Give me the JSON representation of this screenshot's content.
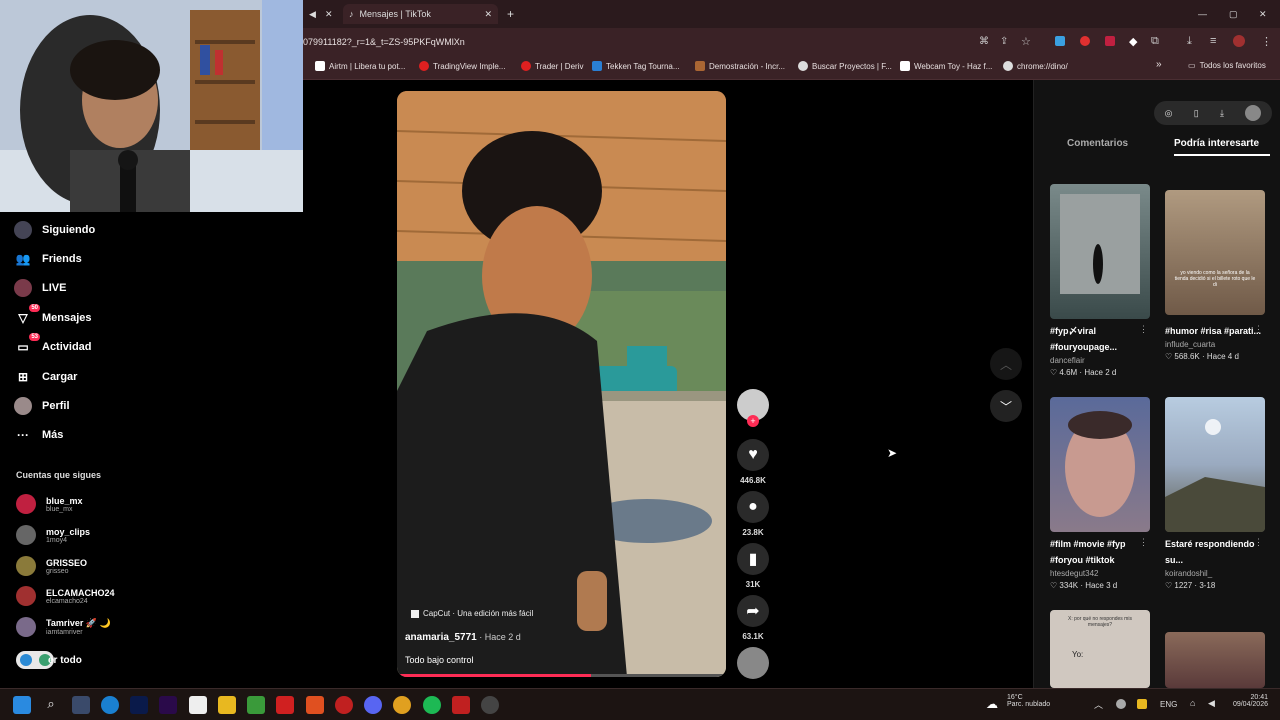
{
  "browser": {
    "tab_close_glyph": "✕",
    "tab_title": "Mensajes | TikTok",
    "new_tab_glyph": "+",
    "url": "079911182?_r=1&_t=ZS-95PKFqWMlXn",
    "window_controls": [
      "—",
      "▢",
      "✕"
    ],
    "bookmarks": [
      {
        "label": "Airtm | Libera tu pot...",
        "color": "#ffffff"
      },
      {
        "label": "TradingView Imple...",
        "color": "#e02020"
      },
      {
        "label": "Trader | Deriv",
        "color": "#e02020"
      },
      {
        "label": "Tekken Tag Tourna...",
        "color": "#2a7fd4"
      },
      {
        "label": "Demostración - Incr...",
        "color": "#aa6633"
      },
      {
        "label": "Buscar Proyectos | F...",
        "color": "#dddddd"
      },
      {
        "label": "Webcam Toy - Haz f...",
        "color": "#ffffff"
      },
      {
        "label": "chrome://dino/",
        "color": "#dddddd"
      }
    ],
    "bookmarks_more": "»",
    "all_favorites": "Todos los favoritos"
  },
  "sidebar": {
    "nav": [
      {
        "label": "Siguiendo",
        "icon": "following-icon"
      },
      {
        "label": "Friends",
        "icon": "friends-icon"
      },
      {
        "label": "LIVE",
        "icon": "live-icon"
      },
      {
        "label": "Mensajes",
        "icon": "messages-icon",
        "badge": "50"
      },
      {
        "label": "Actividad",
        "icon": "activity-icon",
        "badge": "53"
      },
      {
        "label": "Cargar",
        "icon": "upload-icon"
      },
      {
        "label": "Perfil",
        "icon": "profile-icon"
      },
      {
        "label": "Más",
        "icon": "more-icon"
      }
    ],
    "following_title": "Cuentas que sigues",
    "following": [
      {
        "name": "blue_mx",
        "handle": "blue_mx",
        "color": "#c02040"
      },
      {
        "name": "moy_clips",
        "handle": "1moy4",
        "color": "#666666"
      },
      {
        "name": "GRISSEO",
        "handle": "grisseo",
        "color": "#8a7a3a"
      },
      {
        "name": "ELCAMACHO24",
        "handle": "elcamacho24",
        "color": "#a03030"
      },
      {
        "name": "Tamriver 🚀 🌙",
        "handle": "iamtamriver",
        "color": "#7a6a8a"
      }
    ],
    "see_all": "er todo"
  },
  "video": {
    "capcut_label": "CapCut · Una edición más fácil",
    "author": "anamaria_5771",
    "time": " · Hace 2 d",
    "caption": "Todo bajo control",
    "progress": 0.59,
    "actions": {
      "likes": "446.8K",
      "comments": "23.8K",
      "saves": "31K",
      "shares": "63.1K"
    }
  },
  "right_panel": {
    "tabs": [
      "Comentarios",
      "Podría interesarte"
    ],
    "active_tab": 1,
    "cards": [
      {
        "title": "#fyp〆viral #fouryoupage...",
        "author": "danceflair",
        "likes": "4.6M",
        "time": "Hace 2 d",
        "thumb": "#5a6a6a"
      },
      {
        "title": "#humor #risa #parati...",
        "author": "influde_cuarta",
        "likes": "568.6K",
        "time": "Hace 4 d",
        "thumb": "#a08a70"
      },
      {
        "title": "#film #movie #fyp #foryou #tiktok",
        "author": "htesdegut342",
        "likes": "334K",
        "time": "Hace 3 d",
        "thumb": "#6a7a9a"
      },
      {
        "title": "Estaré respondiendo su...",
        "author": "koirandoshil_",
        "likes": "1227",
        "time": "3-18",
        "thumb": "#8aa0b8"
      },
      {
        "title": "",
        "author": "",
        "likes": "",
        "time": "",
        "thumb": "#c8c0b8",
        "overlay": "X: por qué no respondes mis mensajes?"
      },
      {
        "title": "",
        "author": "",
        "likes": "",
        "time": "",
        "thumb": "#7a5a4a"
      }
    ],
    "thumb_captions": [
      "yo viendo como la señora de la tienda decidió si el billete roto que le di",
      "Yo: "
    ]
  },
  "taskbar": {
    "weather_temp": "16°C",
    "weather_desc": "Parc. nublado",
    "lang": "ENG",
    "time": "20:41",
    "date": "09/04/2026"
  }
}
